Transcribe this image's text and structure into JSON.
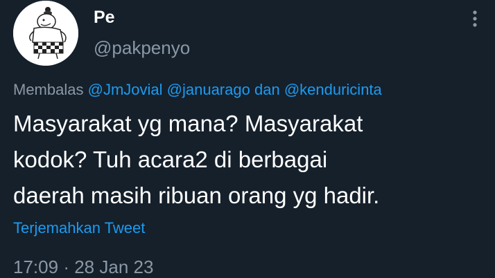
{
  "author": {
    "display_name": "Pe",
    "handle": "@pakpenyo"
  },
  "reply": {
    "prefix": "Membalas",
    "mention_1": "@JmJovial",
    "mention_2": "@januarago",
    "connector": "dan",
    "mention_3": "@kenduricinta"
  },
  "body": {
    "line_1": "Masyarakat yg mana? Masyarakat",
    "line_2": "kodok? Tuh acara2 di berbagai",
    "line_3": "daerah masih ribuan orang yg hadir."
  },
  "translate_label": "Terjemahkan Tweet",
  "meta": {
    "time": "17:09",
    "separator": "·",
    "date": "28 Jan 23"
  },
  "icons": {
    "more": "more-vertical-icon",
    "avatar": "avatar-image"
  },
  "colors": {
    "background": "#15202b",
    "primary_text": "#ffffff",
    "secondary_text": "#8b98a5",
    "accent": "#1d9bf0"
  }
}
